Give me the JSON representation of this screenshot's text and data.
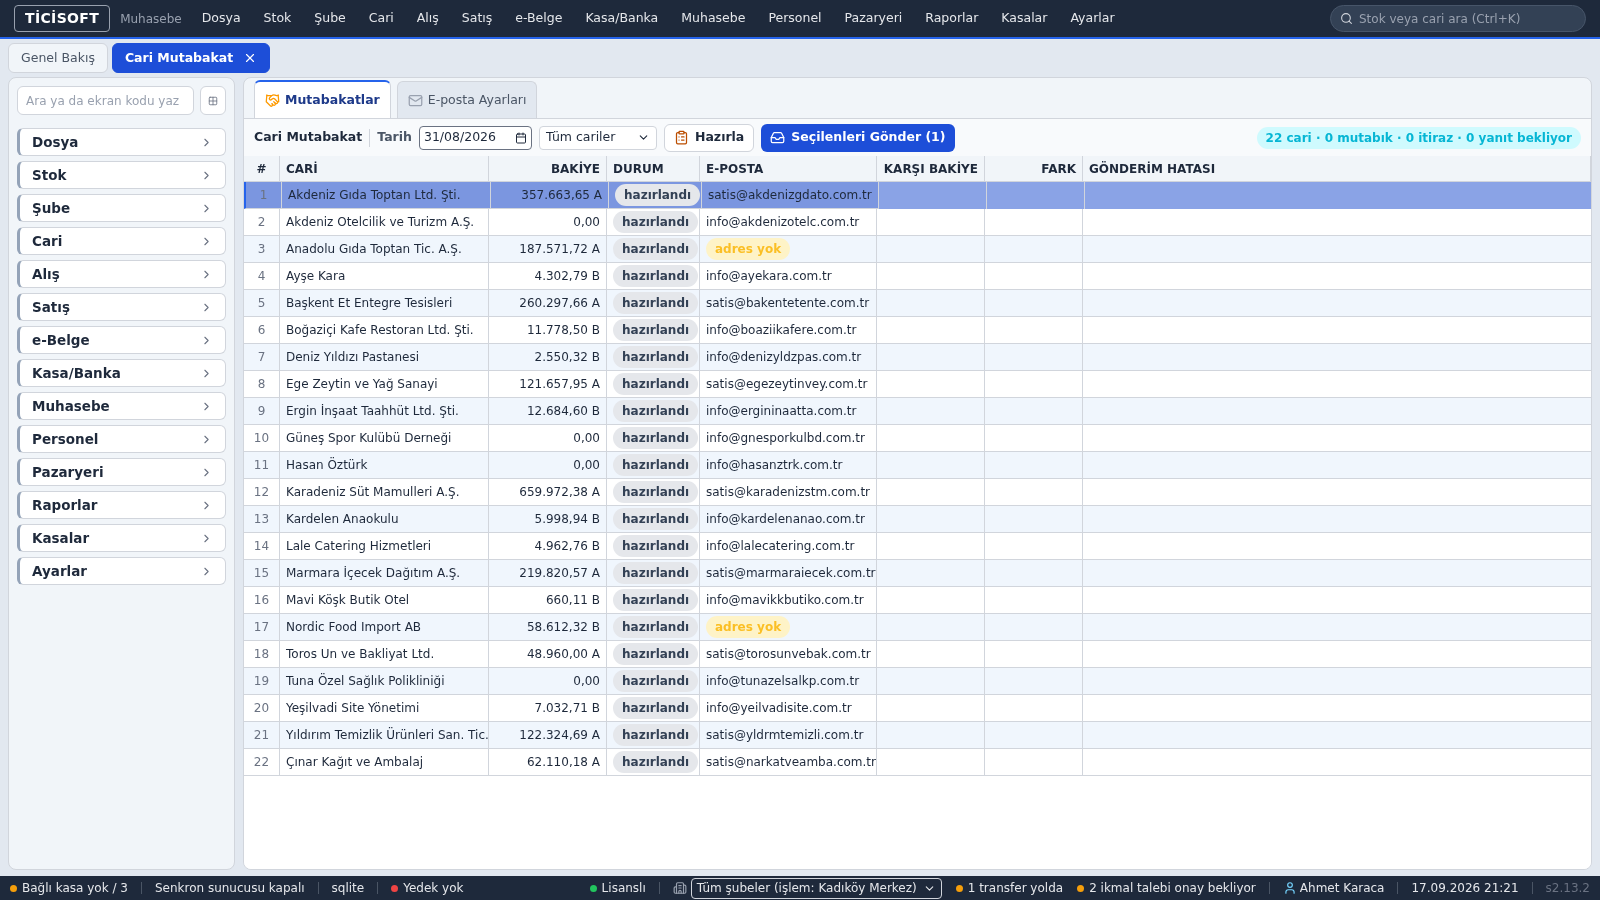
{
  "brand": {
    "logo": "TİCİSOFT",
    "module": "Muhasebe"
  },
  "menu": [
    "Dosya",
    "Stok",
    "Şube",
    "Cari",
    "Alış",
    "Satış",
    "e-Belge",
    "Kasa/Banka",
    "Muhasebe",
    "Personel",
    "Pazaryeri",
    "Raporlar",
    "Kasalar",
    "Ayarlar"
  ],
  "global_search": {
    "placeholder": "Stok veya cari ara (Ctrl+K)"
  },
  "page_tabs": [
    {
      "label": "Genel Bakış",
      "selected": false,
      "closable": false
    },
    {
      "label": "Cari Mutabakat",
      "selected": true,
      "closable": true
    }
  ],
  "sidebar": {
    "search": {
      "placeholder": "Ara ya da ekran kodu yaz"
    },
    "items": [
      "Dosya",
      "Stok",
      "Şube",
      "Cari",
      "Alış",
      "Satış",
      "e-Belge",
      "Kasa/Banka",
      "Muhasebe",
      "Personel",
      "Pazaryeri",
      "Raporlar",
      "Kasalar",
      "Ayarlar"
    ]
  },
  "tabs": [
    {
      "label": "Mutabakatlar",
      "selected": true,
      "kind": "handshake"
    },
    {
      "label": "E-posta Ayarları",
      "selected": false,
      "kind": "mail"
    }
  ],
  "toolbar": {
    "title": "Cari Mutabakat",
    "date_label": "Tarih",
    "date": "31/08/2026",
    "filter": "Tüm cariler",
    "prepare": "Hazırla",
    "send": "Seçilenleri Gönder (1)",
    "summary": "22 cari · 0 mutabık · 0 itiraz · 0 yanıt bekliyor"
  },
  "table": {
    "columns": [
      "#",
      "CARİ",
      "BAKİYE",
      "DURUM",
      "E-POSTA",
      "KARŞI BAKİYE",
      "FARK",
      "GÖNDERİM HATASI"
    ],
    "rows": [
      {
        "no": "1",
        "cari": "Akdeniz Gıda Toptan Ltd. Şti.",
        "bakiye": "357.663,65 A",
        "durum": "hazırlandı",
        "eposta": {
          "kind": "address",
          "text": "satis@akdenizgdato.com.tr"
        },
        "selected": true
      },
      {
        "no": "2",
        "cari": "Akdeniz Otelcilik ve Turizm A.Ş.",
        "bakiye": "0,00",
        "durum": "hazırlandı",
        "eposta": {
          "kind": "address",
          "text": "info@akdenizotelc.com.tr"
        },
        "selected": false
      },
      {
        "no": "3",
        "cari": "Anadolu Gıda Toptan Tic. A.Ş.",
        "bakiye": "187.571,72 A",
        "durum": "hazırlandı",
        "eposta": {
          "kind": "missing",
          "text": "adres yok"
        },
        "selected": false
      },
      {
        "no": "4",
        "cari": "Ayşe Kara",
        "bakiye": "4.302,79 B",
        "durum": "hazırlandı",
        "eposta": {
          "kind": "address",
          "text": "info@ayekara.com.tr"
        },
        "selected": false
      },
      {
        "no": "5",
        "cari": "Başkent Et Entegre Tesisleri",
        "bakiye": "260.297,66 A",
        "durum": "hazırlandı",
        "eposta": {
          "kind": "address",
          "text": "satis@bakentetente.com.tr"
        },
        "selected": false
      },
      {
        "no": "6",
        "cari": "Boğaziçi Kafe Restoran Ltd. Şti.",
        "bakiye": "11.778,50 B",
        "durum": "hazırlandı",
        "eposta": {
          "kind": "address",
          "text": "info@boaziikafere.com.tr"
        },
        "selected": false
      },
      {
        "no": "7",
        "cari": "Deniz Yıldızı Pastanesi",
        "bakiye": "2.550,32 B",
        "durum": "hazırlandı",
        "eposta": {
          "kind": "address",
          "text": "info@denizyldzpas.com.tr"
        },
        "selected": false
      },
      {
        "no": "8",
        "cari": "Ege Zeytin ve Yağ Sanayi",
        "bakiye": "121.657,95 A",
        "durum": "hazırlandı",
        "eposta": {
          "kind": "address",
          "text": "satis@egezeytinvey.com.tr"
        },
        "selected": false
      },
      {
        "no": "9",
        "cari": "Ergin İnşaat Taahhüt Ltd. Şti.",
        "bakiye": "12.684,60 B",
        "durum": "hazırlandı",
        "eposta": {
          "kind": "address",
          "text": "info@ergininaatta.com.tr"
        },
        "selected": false
      },
      {
        "no": "10",
        "cari": "Güneş Spor Kulübü Derneği",
        "bakiye": "0,00",
        "durum": "hazırlandı",
        "eposta": {
          "kind": "address",
          "text": "info@gnesporkulbd.com.tr"
        },
        "selected": false
      },
      {
        "no": "11",
        "cari": "Hasan Öztürk",
        "bakiye": "0,00",
        "durum": "hazırlandı",
        "eposta": {
          "kind": "address",
          "text": "info@hasanztrk.com.tr"
        },
        "selected": false
      },
      {
        "no": "12",
        "cari": "Karadeniz Süt Mamulleri A.Ş.",
        "bakiye": "659.972,38 A",
        "durum": "hazırlandı",
        "eposta": {
          "kind": "address",
          "text": "satis@karadenizstm.com.tr"
        },
        "selected": false
      },
      {
        "no": "13",
        "cari": "Kardelen Anaokulu",
        "bakiye": "5.998,94 B",
        "durum": "hazırlandı",
        "eposta": {
          "kind": "address",
          "text": "info@kardelenanao.com.tr"
        },
        "selected": false
      },
      {
        "no": "14",
        "cari": "Lale Catering Hizmetleri",
        "bakiye": "4.962,76 B",
        "durum": "hazırlandı",
        "eposta": {
          "kind": "address",
          "text": "info@lalecatering.com.tr"
        },
        "selected": false
      },
      {
        "no": "15",
        "cari": "Marmara İçecek Dağıtım A.Ş.",
        "bakiye": "219.820,57 A",
        "durum": "hazırlandı",
        "eposta": {
          "kind": "address",
          "text": "satis@marmaraiecek.com.tr"
        },
        "selected": false
      },
      {
        "no": "16",
        "cari": "Mavi Köşk Butik Otel",
        "bakiye": "660,11 B",
        "durum": "hazırlandı",
        "eposta": {
          "kind": "address",
          "text": "info@mavikkbutiko.com.tr"
        },
        "selected": false
      },
      {
        "no": "17",
        "cari": "Nordic Food Import AB",
        "bakiye": "58.612,32 B",
        "durum": "hazırlandı",
        "eposta": {
          "kind": "missing",
          "text": "adres yok"
        },
        "selected": false
      },
      {
        "no": "18",
        "cari": "Toros Un ve Bakliyat Ltd.",
        "bakiye": "48.960,00 A",
        "durum": "hazırlandı",
        "eposta": {
          "kind": "address",
          "text": "satis@torosunvebak.com.tr"
        },
        "selected": false
      },
      {
        "no": "19",
        "cari": "Tuna Özel Sağlık Polikliniği",
        "bakiye": "0,00",
        "durum": "hazırlandı",
        "eposta": {
          "kind": "address",
          "text": "info@tunazelsalkp.com.tr"
        },
        "selected": false
      },
      {
        "no": "20",
        "cari": "Yeşilvadi Site Yönetimi",
        "bakiye": "7.032,71 B",
        "durum": "hazırlandı",
        "eposta": {
          "kind": "address",
          "text": "info@yeilvadisite.com.tr"
        },
        "selected": false
      },
      {
        "no": "21",
        "cari": "Yıldırım Temizlik Ürünleri San. Tic.",
        "bakiye": "122.324,69 A",
        "durum": "hazırlandı",
        "eposta": {
          "kind": "address",
          "text": "satis@yldrmtemizli.com.tr"
        },
        "selected": false
      },
      {
        "no": "22",
        "cari": "Çınar Kağıt ve Ambalaj",
        "bakiye": "62.110,18 A",
        "durum": "hazırlandı",
        "eposta": {
          "kind": "address",
          "text": "satis@narkatveamba.com.tr"
        },
        "selected": false
      }
    ]
  },
  "status_bar": {
    "left": [
      {
        "text": "Bağlı kasa yok / 3",
        "color": "#f59e0b"
      },
      {
        "text": "Senkron sunucusu kapalı"
      },
      {
        "text": "sqlite"
      },
      {
        "text": "Yedek yok",
        "color": "#ef4444"
      }
    ],
    "license": {
      "text": "Lisanslı",
      "color": "#22c55e"
    },
    "branch": "Tüm şubeler (işlem: Kadıköy Merkez)",
    "alerts": [
      {
        "text": "1 transfer yolda",
        "color": "#f59e0b"
      },
      {
        "text": "2 ikmal talebi onay bekliyor",
        "color": "#f59e0b"
      }
    ],
    "user": "Ahmet Karaca",
    "datetime": "17.09.2026 21:21",
    "version": "s2.13.2"
  }
}
